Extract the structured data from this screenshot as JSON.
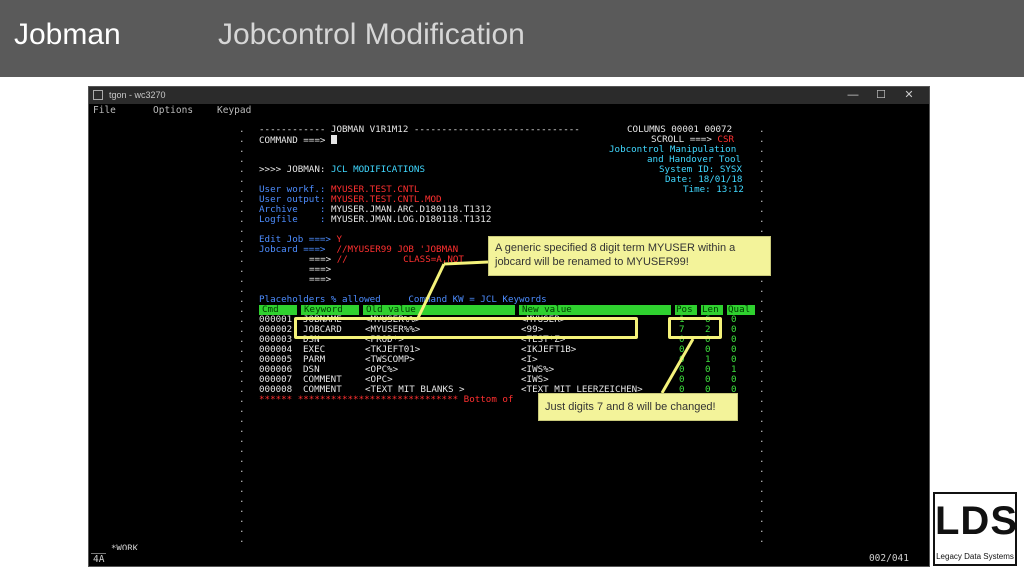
{
  "header": {
    "title": "Jobman",
    "subtitle": "Jobcontrol Modification"
  },
  "window": {
    "title": "tgon - wc3270",
    "menu": [
      "File",
      "Options",
      "Keypad"
    ],
    "status_left": "4A",
    "status_right": "002/041",
    "work_label": "*WORK"
  },
  "screen": {
    "panel_line": "------------ JOBMAN V1R1M12 ------------------------------",
    "columns_label": "COLUMNS 00001 00072",
    "command_label": "COMMAND ===>",
    "scroll_label": "SCROLL ===>",
    "scroll_value": "CSR",
    "tool_title_1": "Jobcontrol Manipulation",
    "tool_title_2": "and Handover Tool",
    "system_id": "System ID: SYSX",
    "date": "Date: 18/01/18",
    "time": "Time: 13:12",
    "prefix": ">>>> JOBMAN:",
    "section": "JCL MODIFICATIONS",
    "user_workf_label": "User workf.:",
    "user_workf_value": "MYUSER.TEST.CNTL",
    "user_output_label": "User output:",
    "user_output_value": "MYUSER.TEST.CNTL.MOD",
    "archive_label": "Archive    :",
    "archive_value": "MYUSER.JMAN.ARC.D180118.T1312",
    "logfile_label": "Logfile    :",
    "logfile_value": "MYUSER.JMAN.LOG.D180118.T1312",
    "editjob_label": "Edit Job ===>",
    "editjob_value": "Y",
    "jobcard_label": "Jobcard ===>",
    "jobcard_value": "//MYUSER99 JOB 'JOBMAN",
    "arrow": "===>",
    "jobcard_cont": "//          CLASS=A,NOT",
    "placeholders_label": "Placeholders % allowed",
    "command_kw": "Command KW = JCL Keywords",
    "col_cmd": "Cmd",
    "col_keyword": "Keyword",
    "col_old": "Old value",
    "col_new": "New value",
    "col_pos": "Pos",
    "col_len": "Len",
    "col_qual": "Qual",
    "rows": [
      {
        "n": "000001",
        "kw": "JOBNAME",
        "old": "<MYUSER%%>",
        "new": "<MYUSER>",
        "pos": "1",
        "len": "6",
        "qual": "0"
      },
      {
        "n": "000002",
        "kw": "JOBCARD",
        "old": "<MYUSER%%>",
        "new": "<99>",
        "pos": "7",
        "len": "2",
        "qual": "0"
      },
      {
        "n": "000003",
        "kw": "DSN",
        "old": "<PROD*>",
        "new": "<TEST*Z>",
        "pos": "0",
        "len": "0",
        "qual": "0"
      },
      {
        "n": "000004",
        "kw": "EXEC",
        "old": "<TKJEFT01>",
        "new": "<IKJEFT1B>",
        "pos": "0",
        "len": "0",
        "qual": "0"
      },
      {
        "n": "000005",
        "kw": "PARM",
        "old": "<TWSCOMP>",
        "new": "<I>",
        "pos": "0",
        "len": "1",
        "qual": "0"
      },
      {
        "n": "000006",
        "kw": "DSN",
        "old": "<OPC%>",
        "new": "<IWS%>",
        "pos": "0",
        "len": "0",
        "qual": "1"
      },
      {
        "n": "000007",
        "kw": "COMMENT",
        "old": "<OPC>",
        "new": "<IWS>",
        "pos": "0",
        "len": "0",
        "qual": "0"
      },
      {
        "n": "000008",
        "kw": "COMMENT",
        "old": "<TEXT MIT BLANKS >",
        "new": "<TEXT MIT LEERZEICHEN>",
        "pos": "0",
        "len": "0",
        "qual": "0"
      }
    ],
    "bottom_line": "****** ***************************** Bottom of"
  },
  "callouts": {
    "top": "A generic specified 8 digit term MYUSER within a jobcard will be renamed to MYUSER99!",
    "bottom": "Just digits 7 and 8 will be changed!"
  },
  "logo": {
    "letters": "LDS",
    "name": "Legacy Data Systems"
  }
}
